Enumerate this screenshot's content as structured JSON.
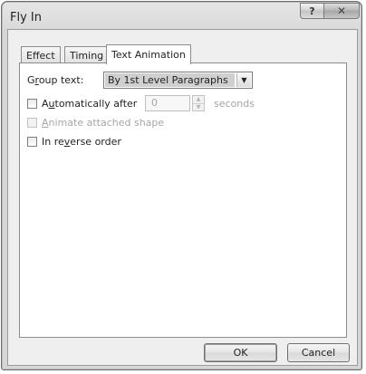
{
  "window": {
    "title": "Fly In",
    "help_label": "?",
    "close_label": "✕"
  },
  "tabs": [
    {
      "label": "Effect",
      "active": false
    },
    {
      "label": "Timing",
      "active": false
    },
    {
      "label": "Text Animation",
      "active": true
    }
  ],
  "group_text": {
    "label_pre": "G",
    "label_ul": "r",
    "label_post": "oup text:",
    "value": "By 1st Level Paragraphs"
  },
  "auto_after": {
    "label_pre": "A",
    "label_ul": "u",
    "label_post": "tomatically after",
    "value": "0",
    "unit": "seconds",
    "checked": false
  },
  "animate_shape": {
    "label_ul": "A",
    "label_post": "nimate attached shape",
    "enabled": false
  },
  "reverse": {
    "label_pre": "In re",
    "label_ul": "v",
    "label_post": "erse order",
    "checked": false
  },
  "buttons": {
    "ok": "OK",
    "cancel": "Cancel"
  }
}
